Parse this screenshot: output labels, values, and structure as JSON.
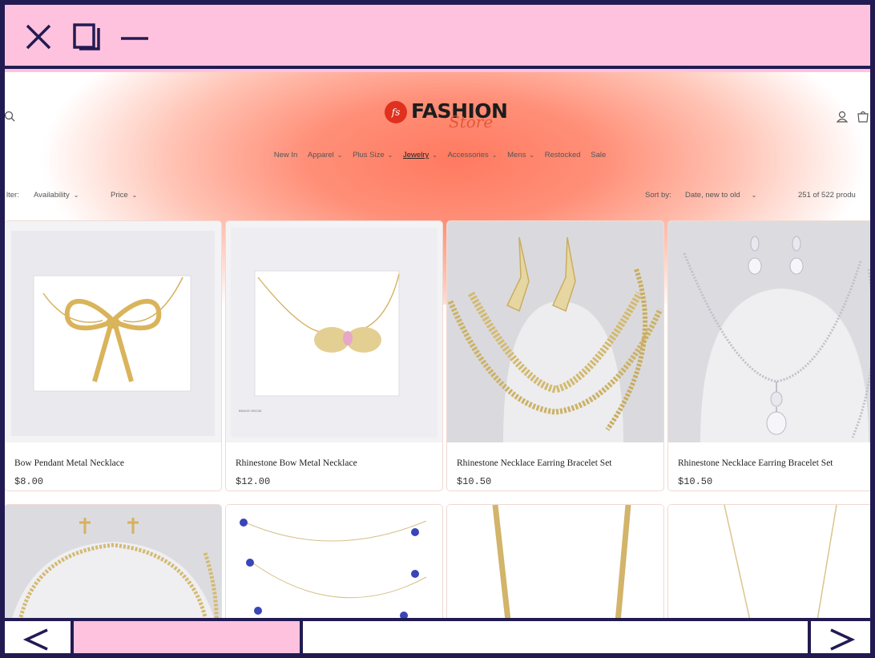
{
  "window": {
    "controls": [
      "close-icon",
      "maximize-icon",
      "minimize-icon"
    ],
    "frame_color": "#221b52",
    "accent_color": "#ffc2de"
  },
  "site": {
    "logo_badge": "fs",
    "logo_word": "FASHION",
    "logo_script": "Store",
    "icons": [
      "search-icon",
      "account-icon",
      "cart-icon"
    ]
  },
  "nav": {
    "items": [
      {
        "label": "New In",
        "dropdown": false,
        "active": false
      },
      {
        "label": "Apparel",
        "dropdown": true,
        "active": false
      },
      {
        "label": "Plus Size",
        "dropdown": true,
        "active": false
      },
      {
        "label": "Jewelry",
        "dropdown": true,
        "active": true
      },
      {
        "label": "Accessories",
        "dropdown": true,
        "active": false
      },
      {
        "label": "Mens",
        "dropdown": true,
        "active": false
      },
      {
        "label": "Restocked",
        "dropdown": false,
        "active": false
      },
      {
        "label": "Sale",
        "dropdown": false,
        "active": false
      }
    ]
  },
  "filters": {
    "label": "lter:",
    "availability": "Availability",
    "price": "Price",
    "sort_label": "Sort by:",
    "sort_value": "Date, new to old",
    "count": "251 of 522 produ"
  },
  "products": [
    {
      "title": "Bow Pendant Metal Necklace",
      "price": "$8.00"
    },
    {
      "title": "Rhinestone Bow Metal Necklace",
      "price": "$12.00"
    },
    {
      "title": "Rhinestone Necklace Earring Bracelet Set",
      "price": "$10.50"
    },
    {
      "title": "Rhinestone Necklace Earring Bracelet Set",
      "price": "$10.50"
    }
  ],
  "scrollbar": {
    "position_fraction": 0.0,
    "visible_fraction": 0.31
  }
}
